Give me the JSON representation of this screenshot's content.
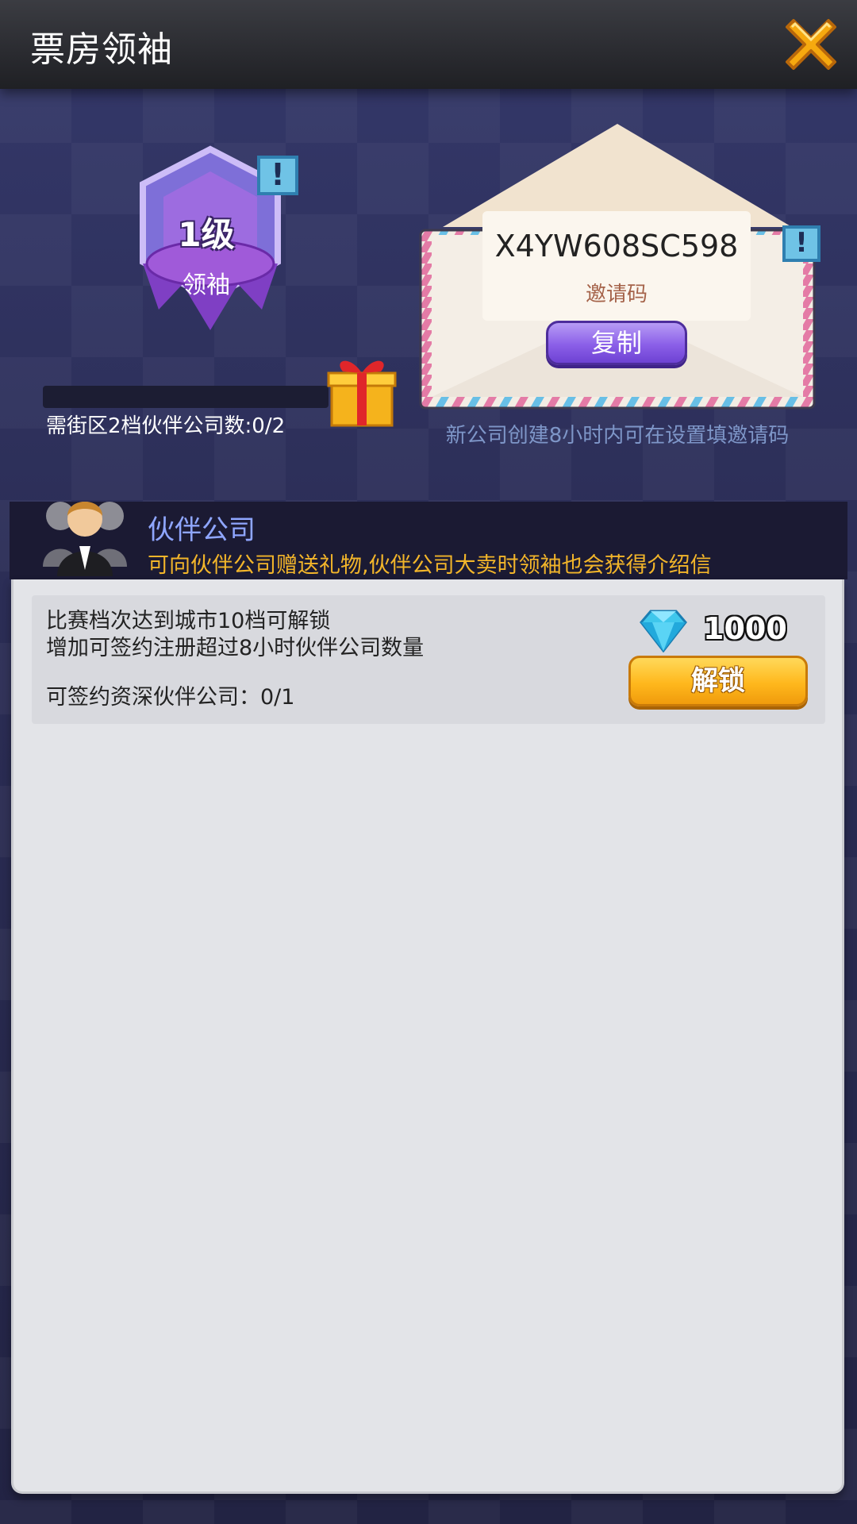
{
  "header": {
    "title": "票房领袖"
  },
  "leader": {
    "level": "1级",
    "title": "领袖",
    "progress_label": "需街区2档伙伴公司数:0/2",
    "progress": 0
  },
  "invite": {
    "code": "X4YW608SC598",
    "label": "邀请码",
    "copy_label": "复制",
    "hint": "新公司创建8小时内可在设置填邀请码"
  },
  "partner": {
    "title": "伙伴公司",
    "description": "可向伙伴公司赠送礼物,伙伴公司大卖时领袖也会获得介绍信"
  },
  "unlock_card": {
    "line1": "比赛档次达到城市10档可解锁",
    "line2": "增加可签约注册超过8小时伙伴公司数量",
    "line3": "可签约资深伙伴公司：0/1",
    "price": "1000",
    "unlock_label": "解锁"
  },
  "icons": {
    "close": "close-icon",
    "alert": "alert-icon",
    "gift": "gift-icon",
    "diamond": "diamond-icon",
    "partner": "partner-group-icon"
  }
}
